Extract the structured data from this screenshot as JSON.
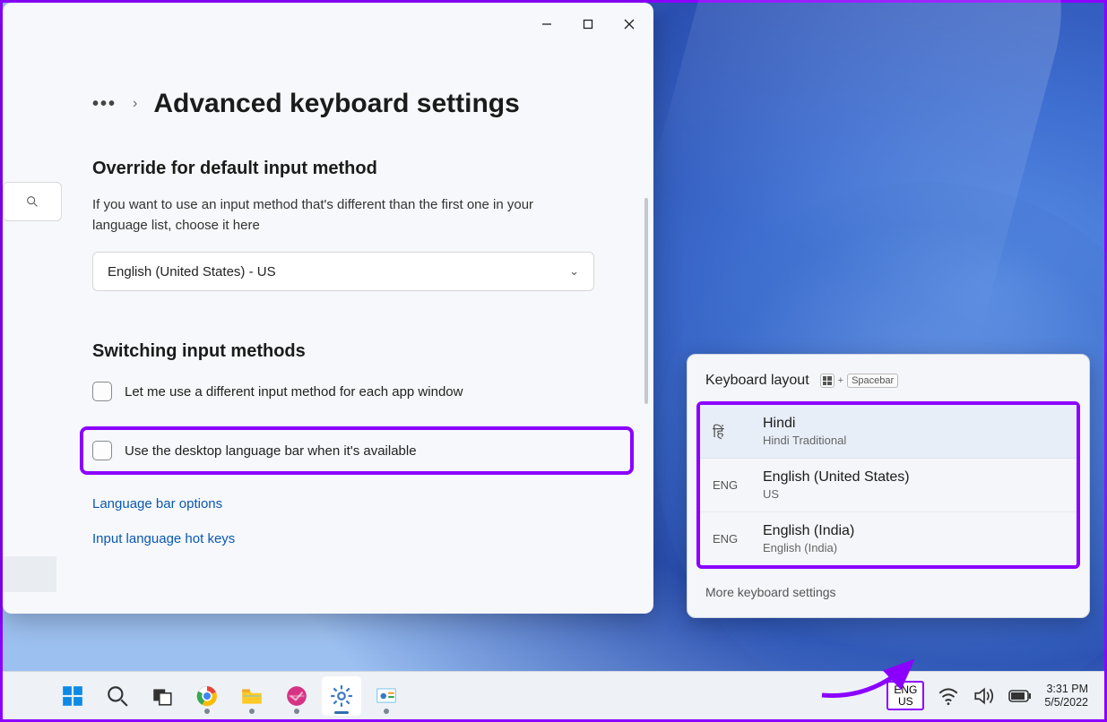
{
  "settings": {
    "breadcrumb_title": "Advanced keyboard settings",
    "section1_title": "Override for default input method",
    "section1_desc": "If you want to use an input method that's different than the first one in your language list, choose it here",
    "dropdown_value": "English (United States) - US",
    "section2_title": "Switching input methods",
    "checkbox1_label": "Let me use a different input method for each app window",
    "checkbox2_label": "Use the desktop language bar when it's available",
    "link1": "Language bar options",
    "link2": "Input language hot keys"
  },
  "flyout": {
    "title": "Keyboard layout",
    "shortcut_key": "Spacebar",
    "items": [
      {
        "code": "हिं",
        "name": "Hindi",
        "sub": "Hindi Traditional",
        "hindi": true,
        "selected": true
      },
      {
        "code": "ENG",
        "name": "English (United States)",
        "sub": "US",
        "selected": false
      },
      {
        "code": "ENG",
        "name": "English (India)",
        "sub": "English (India)",
        "selected": false
      }
    ],
    "more": "More keyboard settings"
  },
  "taskbar": {
    "lang_line1": "ENG",
    "lang_line2": "US",
    "time": "3:31 PM",
    "date": "5/5/2022"
  }
}
